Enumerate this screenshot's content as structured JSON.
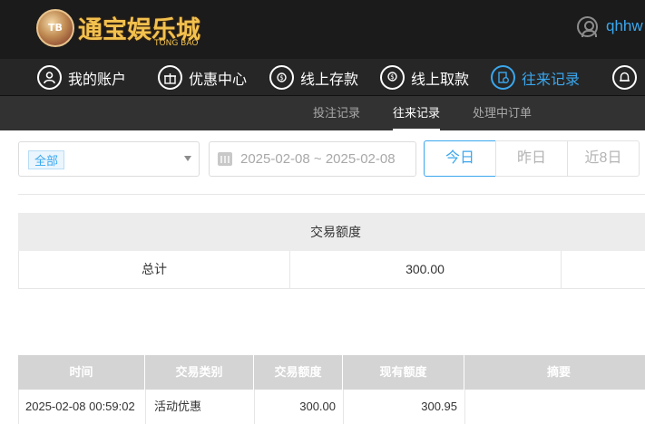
{
  "brand": {
    "name_cn": "通宝娱乐城",
    "name_en": "TONG BAO",
    "badge": "TB"
  },
  "user": {
    "name": "qhhw"
  },
  "main_nav": [
    {
      "label": "我的账户",
      "icon": "user-icon"
    },
    {
      "label": "优惠中心",
      "icon": "gift-icon"
    },
    {
      "label": "线上存款",
      "icon": "deposit-icon"
    },
    {
      "label": "线上取款",
      "icon": "withdraw-icon"
    },
    {
      "label": "往来记录",
      "icon": "records-icon",
      "active": true
    },
    {
      "label": "",
      "icon": "bell-icon"
    }
  ],
  "sub_nav": [
    {
      "label": "投注记录"
    },
    {
      "label": "往来记录",
      "active": true
    },
    {
      "label": "处理中订单"
    }
  ],
  "filters": {
    "type_selected": "全部",
    "date_range": "2025-02-08 ~ 2025-02-08",
    "quick_ranges": [
      "今日",
      "昨日",
      "近8日"
    ],
    "quick_active": "今日"
  },
  "summary": {
    "header": "交易额度",
    "label": "总计",
    "amount": "300.00"
  },
  "records": {
    "columns": [
      "时间",
      "交易类别",
      "交易额度",
      "现有额度",
      "摘要"
    ],
    "rows": [
      {
        "time": "2025-02-08 00:59:02",
        "type": "活动优惠",
        "amount": "300.00",
        "balance": "300.95",
        "memo": ""
      }
    ]
  },
  "colors": {
    "accent": "#3aa7ee",
    "topbar": "#1b1b1b",
    "nav": "#262626",
    "subnav": "#323232",
    "brand_gold": "#f2c14e"
  }
}
